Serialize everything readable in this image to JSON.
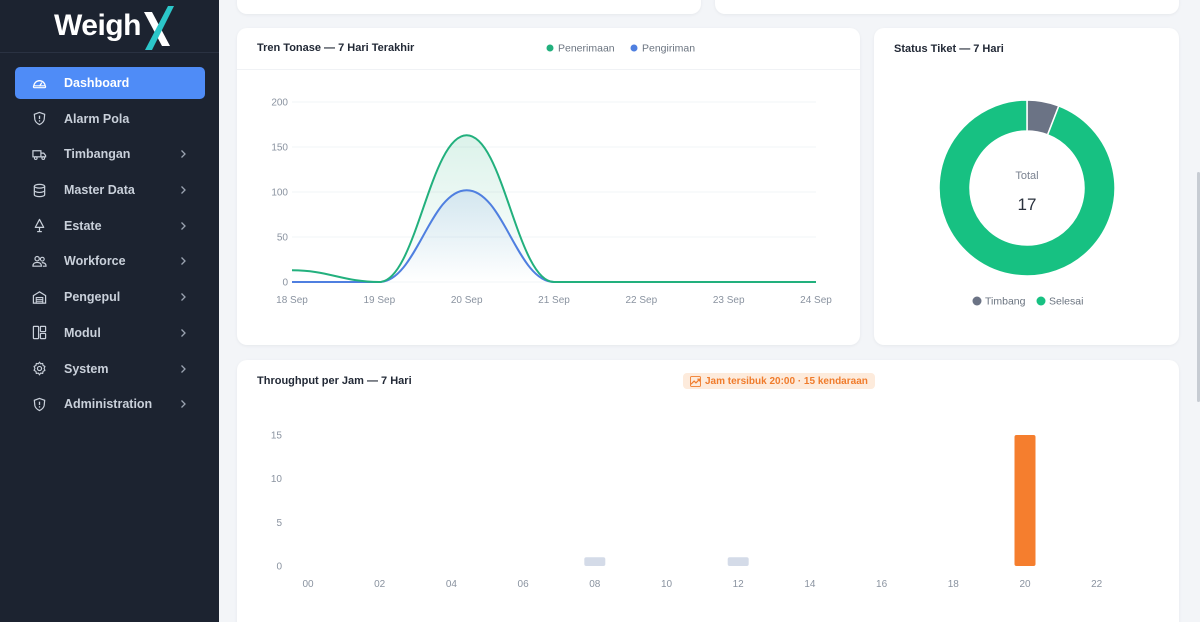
{
  "app": {
    "name_part1": "Weigh",
    "name_part2": "X"
  },
  "sidebar": {
    "items": [
      {
        "label": "Dashboard",
        "icon": "dashboard-icon",
        "active": true,
        "has_children": false
      },
      {
        "label": "Alarm Pola",
        "icon": "shield-alert-icon",
        "active": false,
        "has_children": false
      },
      {
        "label": "Timbangan",
        "icon": "truck-icon",
        "active": false,
        "has_children": true
      },
      {
        "label": "Master Data",
        "icon": "database-icon",
        "active": false,
        "has_children": true
      },
      {
        "label": "Estate",
        "icon": "tree-icon",
        "active": false,
        "has_children": true
      },
      {
        "label": "Workforce",
        "icon": "users-icon",
        "active": false,
        "has_children": true
      },
      {
        "label": "Pengepul",
        "icon": "warehouse-icon",
        "active": false,
        "has_children": true
      },
      {
        "label": "Modul",
        "icon": "layout-icon",
        "active": false,
        "has_children": true
      },
      {
        "label": "System",
        "icon": "gear-icon",
        "active": false,
        "has_children": true
      },
      {
        "label": "Administration",
        "icon": "shield-icon",
        "active": false,
        "has_children": true
      }
    ]
  },
  "colors": {
    "accent": "#4f8cf7",
    "penerimaan": "#22b07d",
    "pengiriman": "#4f7fe0",
    "timbang": "#6b7385",
    "selesai": "#17c182",
    "bar_peak": "#f57e2e",
    "bar_other": "#d4dbe8"
  },
  "tonnage": {
    "title": "Tren Tonase — 7 Hari Terakhir",
    "legend": [
      "Penerimaan",
      "Pengiriman"
    ]
  },
  "status": {
    "title": "Status Tiket — 7 Hari",
    "center_label": "Total",
    "center_value": "17",
    "legend": [
      "Timbang",
      "Selesai"
    ]
  },
  "throughput": {
    "title": "Throughput per Jam — 7 Hari",
    "badge": "Jam tersibuk 20:00 · 15 kendaraan"
  },
  "chart_data": [
    {
      "type": "line",
      "title": "Tren Tonase — 7 Hari Terakhir",
      "categories": [
        "18 Sep",
        "19 Sep",
        "20 Sep",
        "21 Sep",
        "22 Sep",
        "23 Sep",
        "24 Sep"
      ],
      "series": [
        {
          "name": "Penerimaan",
          "values": [
            13,
            0,
            163,
            0,
            0,
            0,
            0
          ]
        },
        {
          "name": "Pengiriman",
          "values": [
            0,
            0,
            102,
            0,
            0,
            0,
            0
          ]
        }
      ],
      "ylim": [
        0,
        200
      ],
      "yticks": [
        0,
        50,
        100,
        150,
        200
      ],
      "legend": "top-center",
      "grid": true
    },
    {
      "type": "pie",
      "title": "Status Tiket — 7 Hari",
      "categories": [
        "Timbang",
        "Selesai"
      ],
      "values": [
        1,
        16
      ],
      "total": 17,
      "legend": "bottom"
    },
    {
      "type": "bar",
      "title": "Throughput per Jam — 7 Hari",
      "categories": [
        "00",
        "01",
        "02",
        "03",
        "04",
        "05",
        "06",
        "07",
        "08",
        "09",
        "10",
        "11",
        "12",
        "13",
        "14",
        "15",
        "16",
        "17",
        "18",
        "19",
        "20",
        "21",
        "22",
        "23"
      ],
      "values": [
        0,
        0,
        0,
        0,
        0,
        0,
        0,
        0,
        1,
        0,
        0,
        0,
        1,
        0,
        0,
        0,
        0,
        0,
        0,
        0,
        15,
        0,
        0,
        0
      ],
      "xticks": [
        "00",
        "02",
        "04",
        "06",
        "08",
        "10",
        "12",
        "14",
        "16",
        "18",
        "20",
        "22"
      ],
      "ylim": [
        0,
        15
      ],
      "yticks": [
        0,
        5,
        10,
        15
      ]
    }
  ]
}
